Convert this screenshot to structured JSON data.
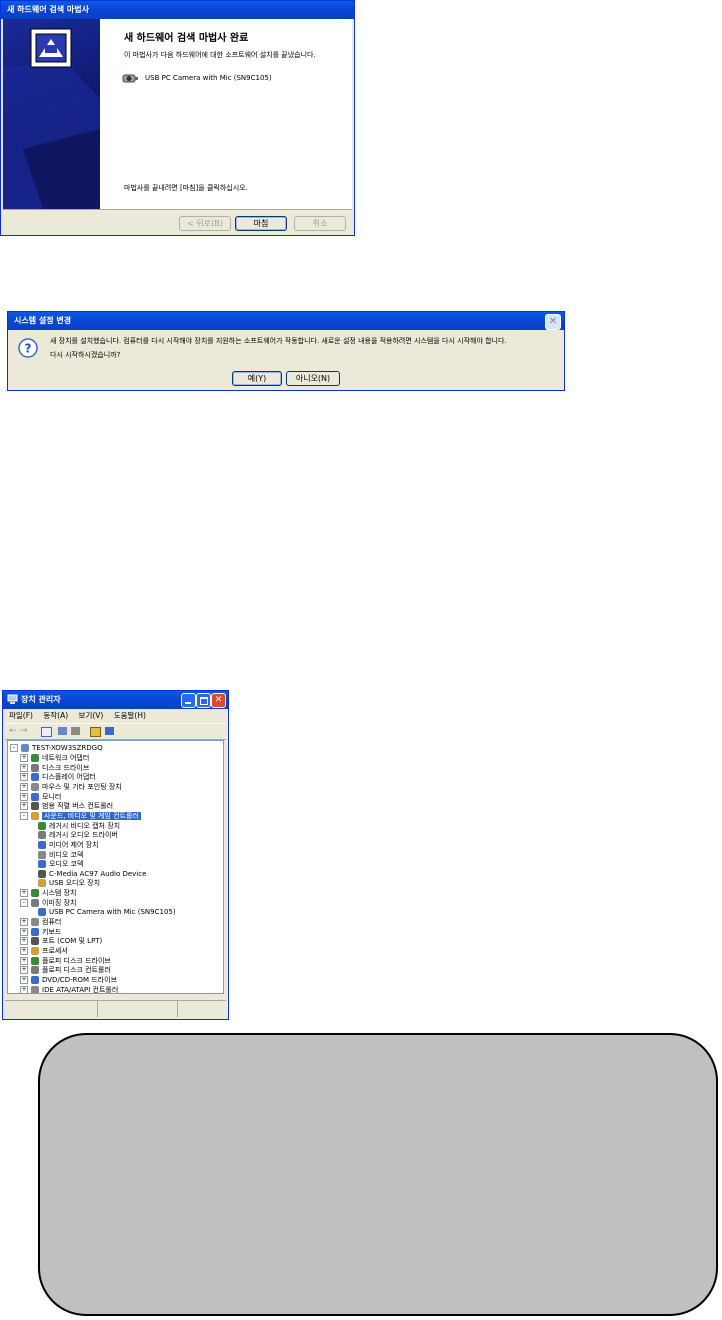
{
  "wizard": {
    "title": "새 하드웨어 검색 마법사",
    "heading": "새 하드웨어 검색 마법사 완료",
    "message": "이 마법사가 다음 하드웨어에 대한 소프트웨어 설치를 끝냈습니다.",
    "device_name": "USB PC Camera with Mic (SN9C105)",
    "finish_hint": "마법사를 끝내려면 [마침]을 클릭하십시오.",
    "back_label": "< 뒤로(B)",
    "finish_label": "마침",
    "cancel_label": "취소"
  },
  "msgbox": {
    "title": "시스템 설정 변경",
    "line1": "새 장치를 설치했습니다. 컴퓨터를 다시 시작해야 장치를 지원하는 소프트웨어가 작동합니다. 새로운 설정 내용을 적용하려면 시스템을 다시 시작해야 합니다.",
    "line2": "다시 시작하시겠습니까?",
    "yes_label": "예(Y)",
    "no_label": "아니오(N)"
  },
  "devmgr": {
    "title": "장치 관리자",
    "menu": [
      "파일(F)",
      "동작(A)",
      "보기(V)",
      "도움말(H)"
    ],
    "root": "TEST-XOW3SZRDGQ",
    "nodes": [
      {
        "label": "네트워크 어댑터",
        "level": 1,
        "exp": "+"
      },
      {
        "label": "디스크 드라이브",
        "level": 1,
        "exp": "+"
      },
      {
        "label": "디스플레이 어댑터",
        "level": 1,
        "exp": "+"
      },
      {
        "label": "마우스 및 기타 포인팅 장치",
        "level": 1,
        "exp": "+"
      },
      {
        "label": "모니터",
        "level": 1,
        "exp": "+"
      },
      {
        "label": "범용 직렬 버스 컨트롤러",
        "level": 1,
        "exp": "+"
      },
      {
        "label": "사운드, 비디오 및 게임 컨트롤러",
        "level": 1,
        "exp": "-",
        "selected": true
      },
      {
        "label": "레거시 비디오 캡처 장치",
        "level": 2
      },
      {
        "label": "레거시 오디오 드라이버",
        "level": 2
      },
      {
        "label": "미디어 제어 장치",
        "level": 2
      },
      {
        "label": "비디오 코덱",
        "level": 2
      },
      {
        "label": "오디오 코덱",
        "level": 2
      },
      {
        "label": "C-Media AC97 Audio Device",
        "level": 2
      },
      {
        "label": "USB 오디오 장치",
        "level": 2
      },
      {
        "label": "시스템 장치",
        "level": 1,
        "exp": "+"
      },
      {
        "label": "이미징 장치",
        "level": 1,
        "exp": "-"
      },
      {
        "label": "USB PC Camera with Mic (SN9C105)",
        "level": 2
      },
      {
        "label": "컴퓨터",
        "level": 1,
        "exp": "+"
      },
      {
        "label": "키보드",
        "level": 1,
        "exp": "+"
      },
      {
        "label": "포트 (COM 및 LPT)",
        "level": 1,
        "exp": "+"
      },
      {
        "label": "프로세서",
        "level": 1,
        "exp": "+"
      },
      {
        "label": "플로피 디스크 드라이브",
        "level": 1,
        "exp": "+"
      },
      {
        "label": "플로피 디스크 컨트롤러",
        "level": 1,
        "exp": "+"
      },
      {
        "label": "DVD/CD-ROM 드라이브",
        "level": 1,
        "exp": "+"
      },
      {
        "label": "IDE ATA/ATAPI 컨트롤러",
        "level": 1,
        "exp": "+"
      }
    ]
  },
  "colors": {
    "xp_blue": "#0a46d8",
    "selection": "#316ac5",
    "note_fill": "#c0c0c0"
  }
}
